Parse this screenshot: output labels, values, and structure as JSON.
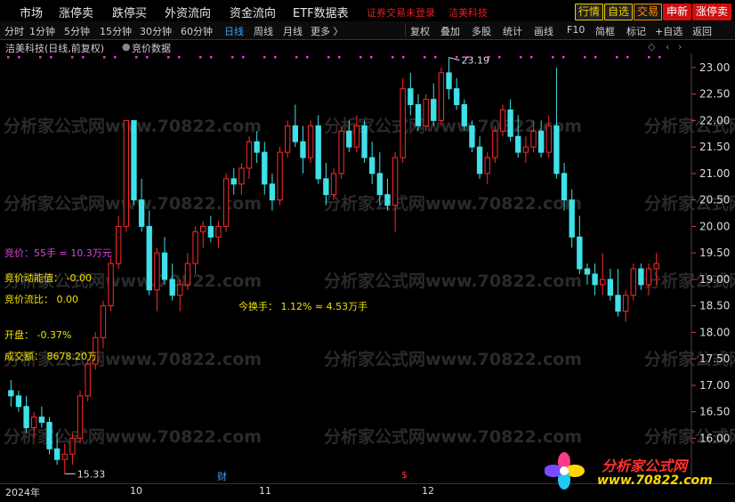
{
  "topbar": {
    "items": [
      "市场",
      "涨停卖",
      "跌停买",
      "外资流向",
      "资金流向",
      "ETF数据表"
    ],
    "alert": "证券交易未登录",
    "stock": "洁美科技",
    "right_buttons": [
      "行情",
      "自选",
      "交易",
      "申新",
      "涨停卖"
    ]
  },
  "tabs": {
    "periods": [
      "分时",
      "1分钟",
      "5分钟",
      "15分钟",
      "30分钟",
      "60分钟",
      "日线",
      "周线",
      "月线",
      "更多 〉"
    ],
    "active": "日线",
    "tools": [
      "复权",
      "叠加",
      "多股",
      "统计",
      "画线",
      "F10",
      "简框",
      "标记",
      "+自选",
      "返回"
    ]
  },
  "titlebar": {
    "stock_title": "洁美科技(日线,前复权)",
    "indicator": "竞价数据"
  },
  "labels": {
    "jingjia": "竞价：55手 = 10.3万元",
    "jingjia_power": "竞价动能值： -0.00",
    "jingjia_flow": "竞价流比： 0.00",
    "turnover": "今换手： 1.12%  ≈  4.53万手",
    "open": "开盘： -0.37%",
    "amount": "成交额： 8678.20万"
  },
  "annotations": {
    "high": "23.19",
    "low": "15.33"
  },
  "dates": {
    "year": "2024年",
    "months": [
      "10",
      "11",
      "12"
    ],
    "marker_cai": "财",
    "marker_s": "$"
  },
  "logo": {
    "text": "分析家公式网",
    "url": "www.70822.com"
  },
  "watermark": "分析家公式网www.70822.com",
  "colors": {
    "up": "#ff2a2a",
    "down": "#3fe0e8",
    "axis": "#ff2a2a",
    "magenta": "#e040e0",
    "yellow": "#f0e000"
  },
  "chart_data": {
    "type": "candlestick",
    "y_ticks": [
      23.0,
      22.5,
      22.0,
      21.5,
      21.0,
      20.5,
      20.0,
      19.5,
      19.0,
      18.5,
      18.0,
      17.5,
      17.0,
      16.5,
      16.0
    ],
    "ylim": [
      15.2,
      23.2
    ],
    "candles": [
      [
        16.9,
        17.1,
        16.6,
        16.8
      ],
      [
        16.8,
        16.9,
        16.5,
        16.6
      ],
      [
        16.6,
        16.8,
        16.1,
        16.2
      ],
      [
        16.2,
        16.5,
        16.0,
        16.4
      ],
      [
        16.4,
        16.6,
        16.2,
        16.3
      ],
      [
        16.3,
        16.4,
        15.7,
        15.8
      ],
      [
        15.8,
        16.1,
        15.5,
        15.6
      ],
      [
        15.6,
        15.9,
        15.33,
        15.7
      ],
      [
        15.7,
        16.1,
        15.5,
        16.0
      ],
      [
        16.0,
        16.9,
        15.9,
        16.8
      ],
      [
        16.8,
        17.5,
        16.7,
        17.4
      ],
      [
        17.4,
        18.0,
        17.3,
        17.9
      ],
      [
        17.9,
        18.6,
        17.7,
        18.5
      ],
      [
        18.5,
        19.4,
        18.4,
        19.3
      ],
      [
        19.3,
        20.2,
        19.2,
        20.0
      ],
      [
        20.0,
        22.0,
        19.9,
        22.0
      ],
      [
        22.0,
        21.8,
        20.4,
        20.5
      ],
      [
        20.5,
        20.9,
        19.9,
        20.0
      ],
      [
        20.0,
        20.3,
        18.7,
        18.8
      ],
      [
        18.8,
        19.6,
        18.4,
        19.5
      ],
      [
        19.5,
        19.8,
        18.9,
        19.0
      ],
      [
        19.0,
        19.3,
        18.6,
        18.7
      ],
      [
        18.7,
        19.0,
        18.4,
        18.9
      ],
      [
        18.9,
        19.5,
        18.8,
        19.3
      ],
      [
        19.3,
        20.0,
        19.1,
        19.9
      ],
      [
        19.9,
        20.1,
        19.6,
        20.0
      ],
      [
        20.0,
        20.2,
        19.7,
        19.8
      ],
      [
        19.8,
        20.1,
        19.6,
        20.0
      ],
      [
        20.0,
        21.0,
        19.9,
        20.9
      ],
      [
        20.9,
        21.1,
        20.6,
        20.8
      ],
      [
        20.8,
        21.2,
        20.6,
        21.1
      ],
      [
        21.1,
        21.7,
        20.9,
        21.6
      ],
      [
        21.6,
        21.8,
        21.2,
        21.4
      ],
      [
        21.4,
        21.6,
        20.6,
        20.8
      ],
      [
        20.8,
        21.0,
        20.3,
        20.5
      ],
      [
        20.5,
        21.5,
        20.4,
        21.4
      ],
      [
        21.4,
        22.0,
        21.3,
        21.9
      ],
      [
        21.9,
        22.3,
        21.5,
        21.6
      ],
      [
        21.6,
        21.9,
        21.0,
        21.3
      ],
      [
        21.3,
        22.0,
        21.2,
        21.9
      ],
      [
        21.9,
        22.1,
        20.8,
        20.9
      ],
      [
        20.9,
        21.2,
        20.4,
        20.6
      ],
      [
        20.6,
        21.1,
        20.5,
        21.0
      ],
      [
        21.0,
        21.9,
        20.9,
        21.8
      ],
      [
        21.8,
        22.0,
        21.4,
        21.5
      ],
      [
        21.5,
        22.1,
        21.4,
        21.9
      ],
      [
        21.9,
        22.0,
        21.2,
        21.3
      ],
      [
        21.3,
        21.6,
        20.8,
        21.0
      ],
      [
        21.0,
        21.4,
        20.4,
        20.6
      ],
      [
        20.6,
        20.9,
        20.3,
        20.4
      ],
      [
        20.4,
        21.4,
        19.9,
        21.3
      ],
      [
        21.3,
        22.8,
        21.2,
        22.6
      ],
      [
        22.6,
        22.9,
        22.1,
        22.3
      ],
      [
        22.3,
        22.5,
        21.8,
        21.9
      ],
      [
        21.9,
        22.5,
        21.8,
        22.4
      ],
      [
        22.4,
        22.7,
        21.9,
        22.0
      ],
      [
        22.0,
        23.0,
        21.9,
        22.9
      ],
      [
        22.9,
        23.19,
        22.4,
        22.6
      ],
      [
        22.6,
        22.8,
        22.2,
        22.3
      ],
      [
        22.3,
        22.4,
        21.8,
        21.9
      ],
      [
        21.9,
        22.0,
        21.4,
        21.5
      ],
      [
        21.5,
        21.7,
        20.9,
        21.0
      ],
      [
        21.0,
        21.4,
        20.8,
        21.3
      ],
      [
        21.3,
        21.9,
        21.2,
        21.8
      ],
      [
        21.8,
        22.3,
        21.7,
        22.2
      ],
      [
        22.2,
        22.4,
        21.6,
        21.7
      ],
      [
        21.7,
        22.1,
        21.3,
        21.4
      ],
      [
        21.4,
        21.7,
        21.2,
        21.5
      ],
      [
        21.5,
        22.0,
        21.4,
        21.8
      ],
      [
        21.8,
        22.0,
        21.3,
        21.4
      ],
      [
        21.4,
        22.1,
        21.3,
        21.9
      ],
      [
        21.9,
        23.0,
        20.9,
        21.0
      ],
      [
        21.0,
        21.2,
        20.3,
        20.5
      ],
      [
        20.5,
        20.7,
        19.6,
        19.8
      ],
      [
        19.8,
        20.2,
        19.1,
        19.2
      ],
      [
        19.2,
        19.3,
        18.9,
        19.1
      ],
      [
        19.1,
        19.3,
        18.7,
        18.9
      ],
      [
        18.9,
        19.5,
        18.7,
        19.0
      ],
      [
        19.0,
        19.2,
        18.6,
        18.7
      ],
      [
        18.7,
        19.2,
        18.3,
        18.4
      ],
      [
        18.4,
        18.8,
        18.2,
        18.7
      ],
      [
        18.7,
        19.3,
        18.6,
        19.2
      ],
      [
        19.2,
        19.3,
        18.8,
        18.9
      ],
      [
        18.9,
        19.3,
        18.7,
        19.2
      ],
      [
        19.2,
        19.5,
        18.9,
        19.3
      ]
    ]
  }
}
